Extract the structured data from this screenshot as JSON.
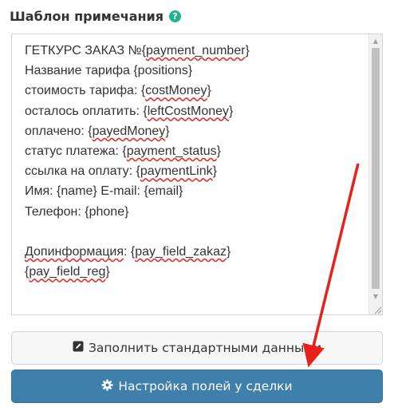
{
  "field": {
    "label": "Шаблон примечания",
    "help_icon": "question-circle-icon",
    "help_glyph": "?"
  },
  "template_lines": [
    [
      "ГЕТКУРС ЗАКАЗ №{",
      {
        "w": "payment_number"
      },
      "}"
    ],
    [
      "Название тарифа {positions}"
    ],
    [
      "стоимость тарифа: {",
      {
        "w": "costMoney"
      },
      "}"
    ],
    [
      "осталось оплатить: {",
      {
        "w": "leftCostMoney"
      },
      "}"
    ],
    [
      "оплачено: {",
      {
        "w": "payedMoney"
      },
      "}"
    ],
    [
      "статус платежа: {",
      {
        "w": "payment_status"
      },
      "}"
    ],
    [
      "ссылка на оплату: {",
      {
        "w": "paymentLink"
      },
      "}"
    ],
    [
      "Имя: {name} E-mail: {email}"
    ],
    [
      "Телефон: {phone}"
    ],
    [
      ""
    ],
    [
      {
        "w": "Допинформация"
      },
      ": {",
      {
        "w": "pay_field_zakaz"
      },
      "}"
    ],
    [
      "{",
      {
        "w": "pay_field_reg"
      },
      "}"
    ]
  ],
  "buttons": {
    "fill_default": {
      "label": "Заполнить стандартными данными",
      "icon": "edit-icon"
    },
    "deal_fields": {
      "label": "Настройка полей у сделки",
      "icon": "gear-icon"
    }
  },
  "colors": {
    "help_icon": "#1fb390",
    "primary_button": "#3f7fab",
    "annotation_arrow": "#e8201a"
  }
}
